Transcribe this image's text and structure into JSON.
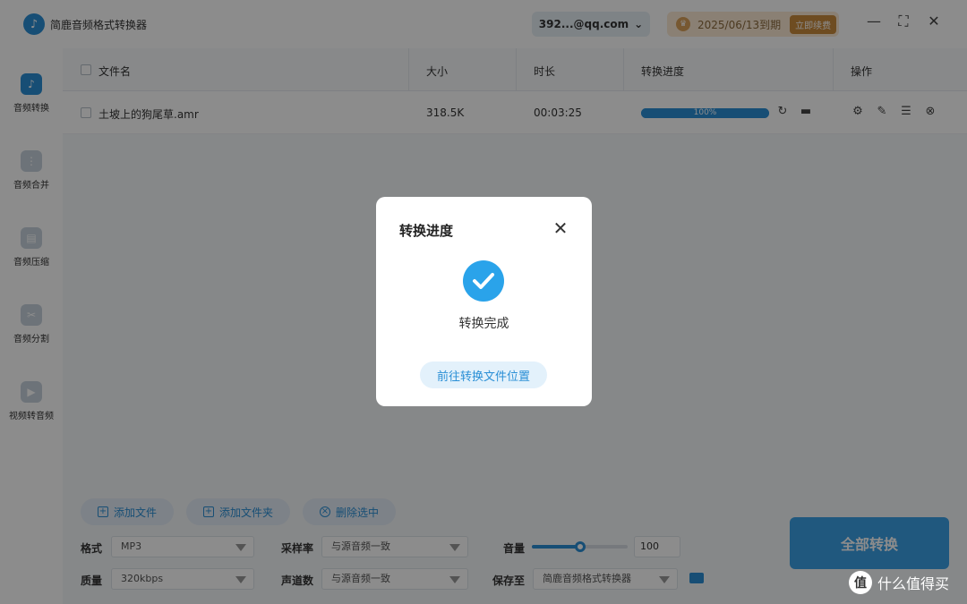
{
  "app": {
    "title": "简鹿音频格式转换器"
  },
  "account": {
    "label": "392...@qq.com"
  },
  "vip": {
    "date_text": "2025/06/13到期",
    "renew_label": "立即续费"
  },
  "window_controls": {
    "minimize": "—",
    "maximize": "⛶",
    "close": "✕"
  },
  "sidebar": {
    "items": [
      {
        "label": "音频转换",
        "active": true
      },
      {
        "label": "音频合并",
        "active": false
      },
      {
        "label": "音频压缩",
        "active": false
      },
      {
        "label": "音频分割",
        "active": false
      },
      {
        "label": "视频转音频",
        "active": false
      }
    ]
  },
  "table": {
    "headers": {
      "filename": "文件名",
      "size": "大小",
      "duration": "时长",
      "progress": "转换进度",
      "actions": "操作"
    },
    "rows": [
      {
        "filename": "土坡上的狗尾草.amr",
        "size": "318.5K",
        "duration": "00:03:25",
        "progress_text": "100%",
        "progress": 1.0
      }
    ]
  },
  "toolbar": {
    "add_file": "添加文件",
    "add_folder": "添加文件夹",
    "delete_selected": "删除选中"
  },
  "settings": {
    "format_label": "格式",
    "format_value": "MP3",
    "quality_label": "质量",
    "quality_value": "320kbps",
    "sample_rate_label": "采样率",
    "sample_rate_value": "与源音频一致",
    "channels_label": "声道数",
    "channels_value": "与源音频一致",
    "volume_label": "音量",
    "volume_value": "100",
    "volume_level": 0.5,
    "save_to_label": "保存至",
    "save_to_value": "简鹿音频格式转换器"
  },
  "convert_all_label": "全部转换",
  "dialog": {
    "title": "转换进度",
    "status": "转换完成",
    "open_location": "前往转换文件位置"
  },
  "watermark": {
    "text": "什么值得买",
    "logo_text": "值"
  },
  "colors": {
    "accent": "#2a8fd6",
    "vip_bg": "#fce9d3",
    "vip_btn": "#c98a3c"
  }
}
